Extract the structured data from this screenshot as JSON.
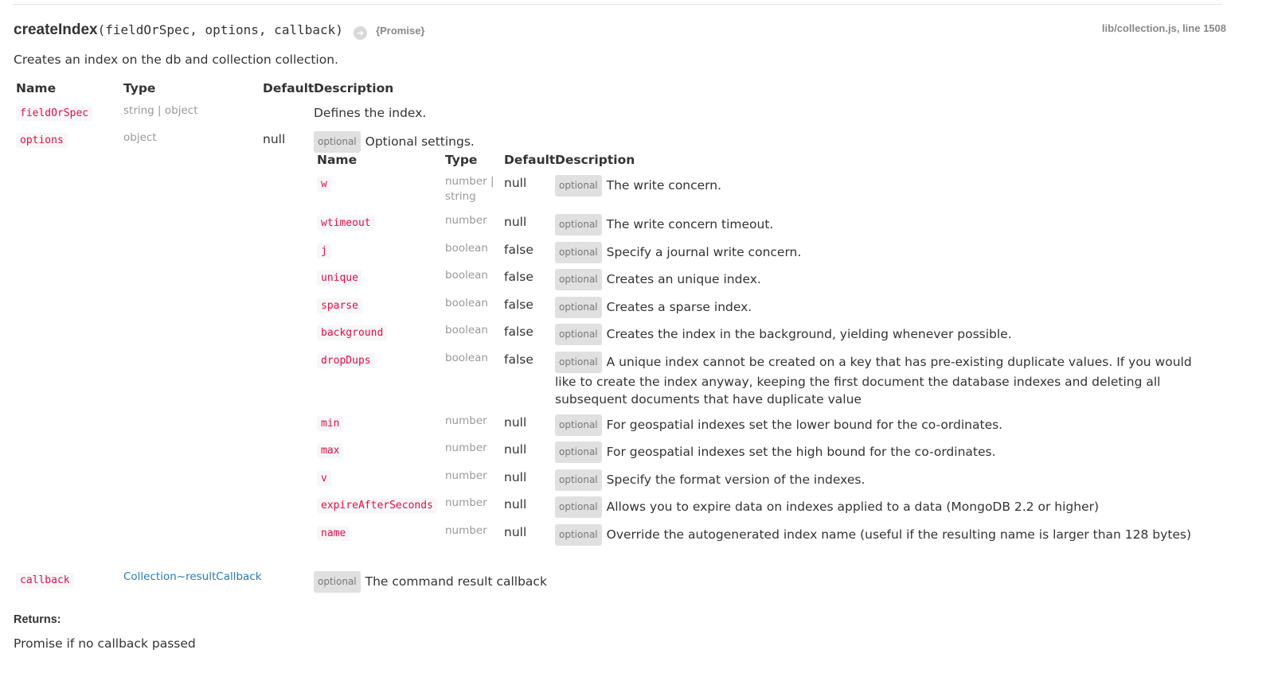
{
  "header": {
    "method_name": "createIndex",
    "signature": "(fieldOrSpec, options, callback)",
    "returns_icon": "arrow-right-icon",
    "returns_type": "{Promise}",
    "source_file": "lib/collection.js",
    "source_line": ", line 1508"
  },
  "description": "Creates an index on the db and collection collection.",
  "params_headers": {
    "name": "Name",
    "type": "Type",
    "default": "Default",
    "description": "Description"
  },
  "params": [
    {
      "name": "fieldOrSpec",
      "type": "string | object",
      "default": "",
      "description": "Defines the index."
    },
    {
      "name": "options",
      "type": "object",
      "default": "null",
      "badge": "optional",
      "description": "Optional settings."
    },
    {
      "name": "callback",
      "type": "Collection~resultCallback",
      "default": "",
      "badge": "optional",
      "description": "The command result callback"
    }
  ],
  "options_headers": {
    "name": "Name",
    "type": "Type",
    "default": "Default",
    "description": "Description"
  },
  "options": [
    {
      "name": "w",
      "type": "number | string",
      "default": "null",
      "badge": "optional",
      "description": "The write concern."
    },
    {
      "name": "wtimeout",
      "type": "number",
      "default": "null",
      "badge": "optional",
      "description": "The write concern timeout."
    },
    {
      "name": "j",
      "type": "boolean",
      "default": "false",
      "badge": "optional",
      "description": "Specify a journal write concern."
    },
    {
      "name": "unique",
      "type": "boolean",
      "default": "false",
      "badge": "optional",
      "description": "Creates an unique index."
    },
    {
      "name": "sparse",
      "type": "boolean",
      "default": "false",
      "badge": "optional",
      "description": "Creates a sparse index."
    },
    {
      "name": "background",
      "type": "boolean",
      "default": "false",
      "badge": "optional",
      "description": "Creates the index in the background, yielding whenever possible."
    },
    {
      "name": "dropDups",
      "type": "boolean",
      "default": "false",
      "badge": "optional",
      "description": "A unique index cannot be created on a key that has pre-existing duplicate values. If you would like to create the index anyway, keeping the first document the database indexes and deleting all subsequent documents that have duplicate value"
    },
    {
      "name": "min",
      "type": "number",
      "default": "null",
      "badge": "optional",
      "description": "For geospatial indexes set the lower bound for the co-ordinates."
    },
    {
      "name": "max",
      "type": "number",
      "default": "null",
      "badge": "optional",
      "description": "For geospatial indexes set the high bound for the co-ordinates."
    },
    {
      "name": "v",
      "type": "number",
      "default": "null",
      "badge": "optional",
      "description": "Specify the format version of the indexes."
    },
    {
      "name": "expireAfterSeconds",
      "type": "number",
      "default": "null",
      "badge": "optional",
      "description": "Allows you to expire data on indexes applied to a data (MongoDB 2.2 or higher)"
    },
    {
      "name": "name",
      "type": "number",
      "default": "null",
      "badge": "optional",
      "description": "Override the autogenerated index name (useful if the resulting name is larger than 128 bytes)"
    }
  ],
  "returns": {
    "label": "Returns:",
    "text": "Promise if no callback passed"
  },
  "colors": {
    "code_text": "#dd1144",
    "code_bg": "#f7f7f9",
    "badge_bg": "#e0e0e0",
    "link": "#2a7ab0",
    "muted": "#999999"
  }
}
